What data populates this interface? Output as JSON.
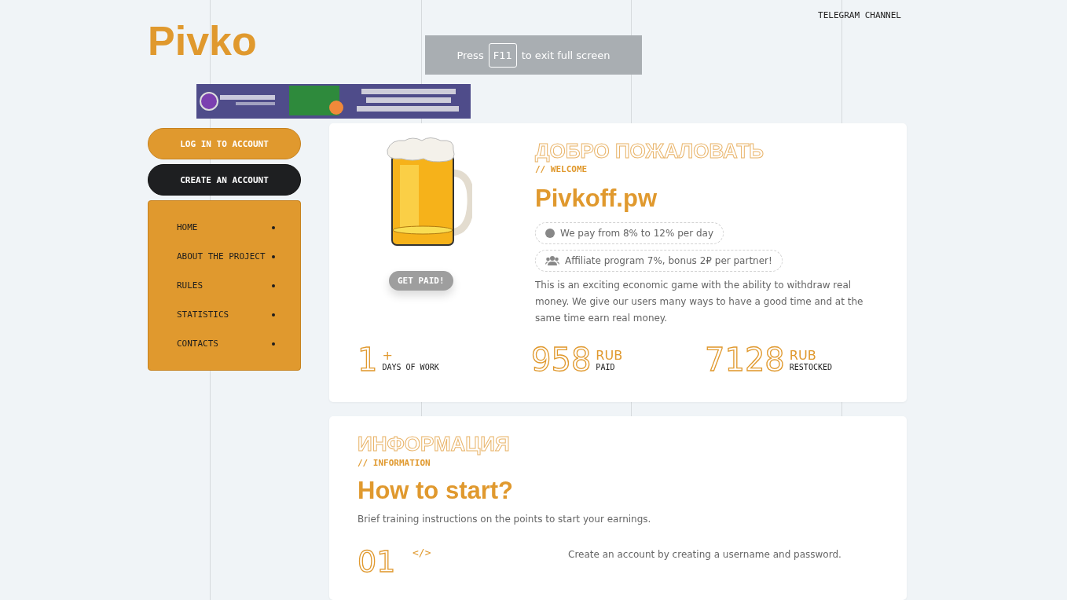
{
  "header": {
    "logo": "Pivko",
    "telegram_link": "TELEGRAM CHANNEL"
  },
  "fullscreen_notice": {
    "before": "Press",
    "key": "F11",
    "after": "to exit full screen"
  },
  "sidebar": {
    "login_button": "LOG IN TO ACCOUNT",
    "create_button": "CREATE AN ACCOUNT",
    "menu": [
      {
        "label": "HOME"
      },
      {
        "label": "ABOUT THE PROJECT"
      },
      {
        "label": "RULES"
      },
      {
        "label": "STATISTICS"
      },
      {
        "label": "CONTACTS"
      }
    ]
  },
  "welcome": {
    "ghost_title": "ДОБРО ПОЖАЛОВАТЬ",
    "eyebrow": "// WELCOME",
    "title": "Pivkoff.pw",
    "badge": "GET PAID!",
    "features": [
      {
        "kind": "dot",
        "text": "We pay from 8% to 12% per day"
      },
      {
        "kind": "users",
        "text": "Affiliate program 7%, bonus 2₽ per partner!"
      }
    ],
    "description": "This is an exciting economic game with the ability to withdraw real money. We give our users many ways to have a good time and at the same time earn real money.",
    "stats": [
      {
        "value": "1",
        "unit": "+",
        "label": "DAYS OF WORK"
      },
      {
        "value": "958",
        "unit": "RUB",
        "label": "PAID"
      },
      {
        "value": "7128",
        "unit": "RUB",
        "label": "RESTOCKED"
      }
    ]
  },
  "info": {
    "ghost_title": "ИНФОРМАЦИЯ",
    "eyebrow": "// INFORMATION",
    "title": "How to start?",
    "subtitle": "Brief training instructions on the points to start your earnings.",
    "steps": [
      {
        "number": "01",
        "icon": "</>",
        "text": "Create an account by creating a username and password."
      }
    ]
  }
}
